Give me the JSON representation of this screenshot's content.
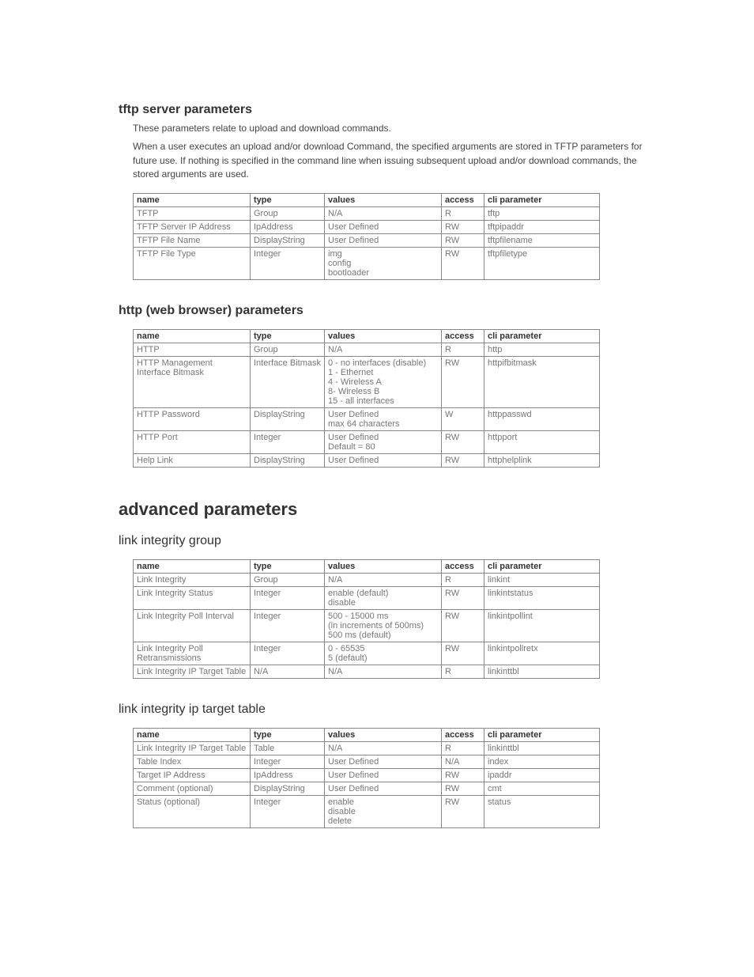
{
  "sections": {
    "tftp": {
      "title": "tftp server parameters",
      "p1": "These parameters relate to upload and download commands.",
      "p2": "When a user executes an upload and/or download Command, the specified arguments are stored in TFTP parameters for future use. If nothing is specified in the command line when issuing subsequent upload and/or download commands, the stored arguments are used."
    },
    "http": {
      "title": "http (web browser) parameters"
    },
    "adv": {
      "title": "advanced parameters"
    },
    "lig": {
      "title": "link integrity group"
    },
    "litt": {
      "title": "link integrity ip target table"
    }
  },
  "headers": {
    "name": "name",
    "type": "type",
    "values": "values",
    "access": "access",
    "cli": "cli parameter"
  },
  "tables": {
    "tftp": [
      {
        "name": "TFTP",
        "type": "Group",
        "values": "N/A",
        "access": "R",
        "cli": "tftp"
      },
      {
        "name": "TFTP Server IP Address",
        "type": "IpAddress",
        "values": "User Defined",
        "access": "RW",
        "cli": "tftpipaddr"
      },
      {
        "name": "TFTP File Name",
        "type": "DisplayString",
        "values": "User Defined",
        "access": "RW",
        "cli": "tftpfilename"
      },
      {
        "name": "TFTP File Type",
        "type": "Integer",
        "values": "img\nconfig\nbootloader",
        "access": "RW",
        "cli": "tftpfiletype"
      }
    ],
    "http": [
      {
        "name": "HTTP",
        "type": "Group",
        "values": "N/A",
        "access": "R",
        "cli": "http"
      },
      {
        "name": "HTTP Management Interface Bitmask",
        "type": "Interface Bitmask",
        "values": "0 - no interfaces (disable)\n1 - Ethernet\n4 - Wireless A\n8- Wireless B\n15 - all interfaces",
        "access": "RW",
        "cli": "httpifbitmask"
      },
      {
        "name": "HTTP Password",
        "type": "DisplayString",
        "values": "User Defined\nmax 64 characters",
        "access": "W",
        "cli": "httppasswd"
      },
      {
        "name": "HTTP Port",
        "type": "Integer",
        "values": "User Defined\nDefault = 80",
        "access": "RW",
        "cli": "httpport"
      },
      {
        "name": "Help Link",
        "type": "DisplayString",
        "values": "User Defined",
        "access": "RW",
        "cli": "httphelplink"
      }
    ],
    "lig": [
      {
        "name": "Link Integrity",
        "type": "Group",
        "values": "N/A",
        "access": "R",
        "cli": "linkint"
      },
      {
        "name": "Link Integrity Status",
        "type": "Integer",
        "values": "enable (default)\ndisable",
        "access": "RW",
        "cli": "linkintstatus"
      },
      {
        "name": "Link Integrity Poll Interval",
        "type": "Integer",
        "values": "500 - 15000 ms\n(in increments of 500ms)\n500 ms (default)",
        "access": "RW",
        "cli": "linkintpollint"
      },
      {
        "name": "Link Integrity Poll Retransmissions",
        "type": "Integer",
        "values": "0 - 65535\n5 (default)",
        "access": "RW",
        "cli": "linkintpollretx"
      },
      {
        "name": "Link Integrity IP Target Table",
        "type": "N/A",
        "values": "N/A",
        "access": "R",
        "cli": "linkinttbl"
      }
    ],
    "litt": [
      {
        "name": "Link Integrity IP Target Table",
        "type": "Table",
        "values": "N/A",
        "access": "R",
        "cli": "linkinttbl"
      },
      {
        "name": "Table Index",
        "type": "Integer",
        "values": "User Defined",
        "access": "N/A",
        "cli": "index"
      },
      {
        "name": "Target IP Address",
        "type": "IpAddress",
        "values": "User Defined",
        "access": "RW",
        "cli": "ipaddr"
      },
      {
        "name": "Comment (optional)",
        "type": "DisplayString",
        "values": "User Defined",
        "access": "RW",
        "cli": "cmt"
      },
      {
        "name": "Status (optional)",
        "type": "Integer",
        "values": "enable\ndisable\ndelete",
        "access": "RW",
        "cli": "status"
      }
    ]
  }
}
